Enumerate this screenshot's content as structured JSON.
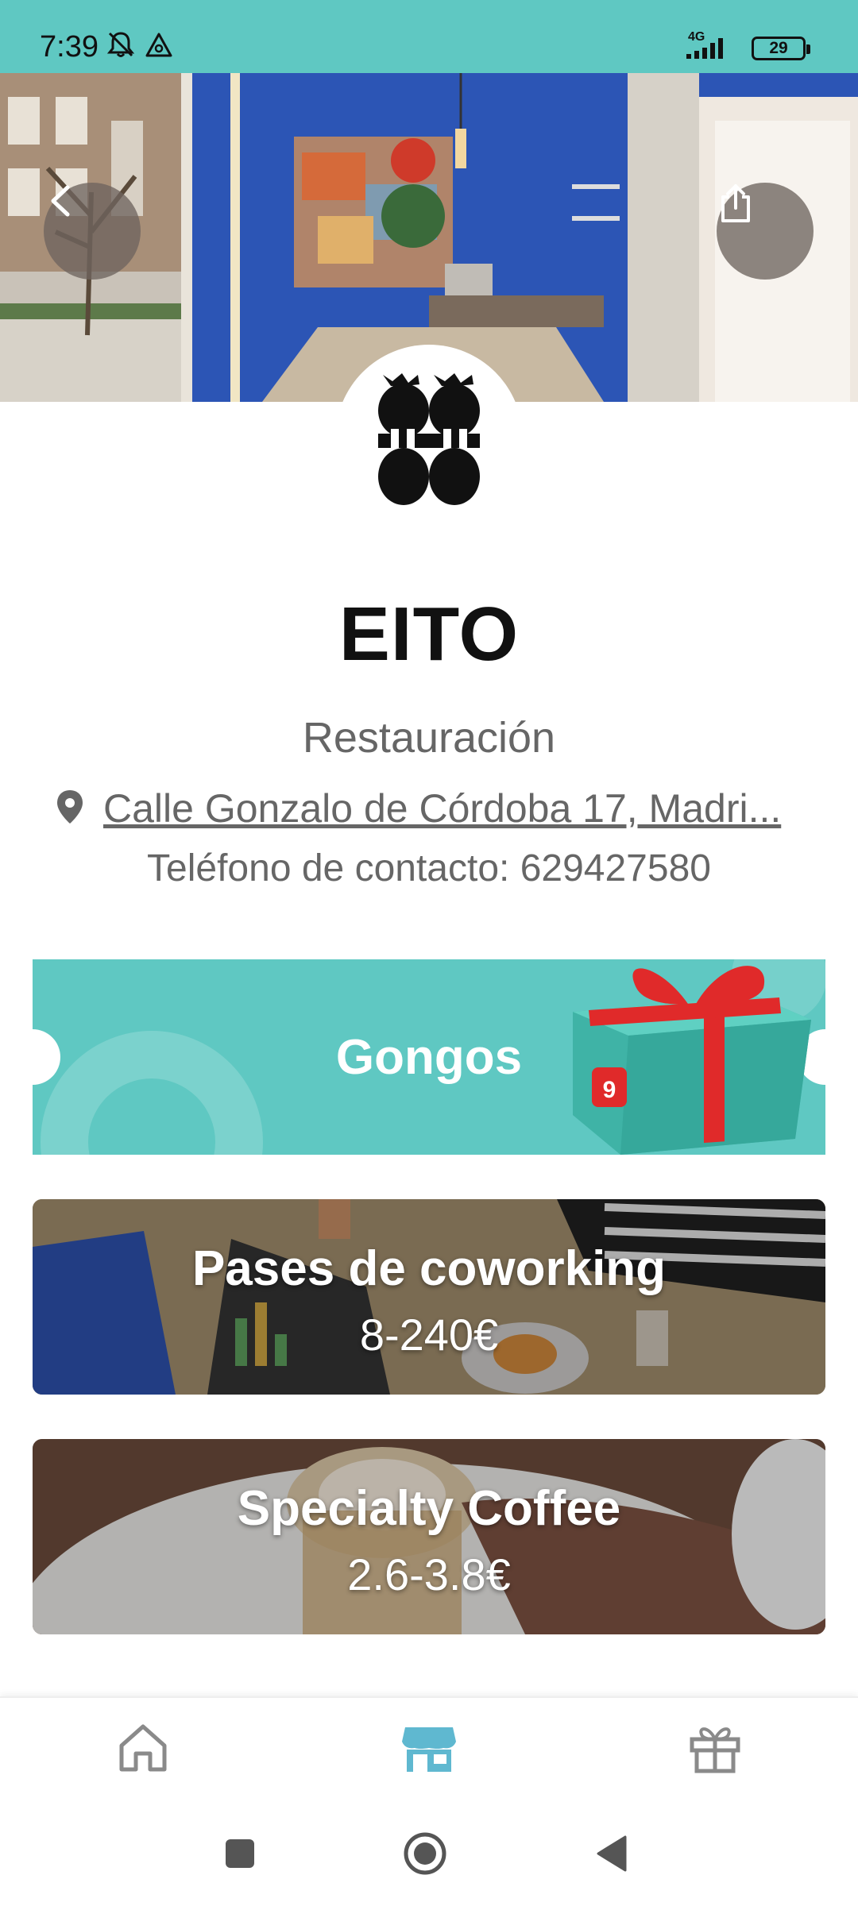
{
  "status_bar": {
    "time": "7:39",
    "network": "4G",
    "battery": "29",
    "icons": [
      "mute-bell-icon",
      "alert-triangle-icon",
      "signal-icon",
      "battery-icon"
    ]
  },
  "hero": {
    "back_icon": "chevron-left-icon",
    "share_icon": "share-icon"
  },
  "venue": {
    "name": "EITO",
    "category": "Restauración",
    "address": "Calle Gonzalo de Córdoba 17, Madri...",
    "phone": "Teléfono de contacto: 629427580"
  },
  "cards": {
    "gongos": {
      "title": "Gongos",
      "badge": "9"
    },
    "coworking": {
      "title": "Pases de coworking",
      "price": "8-240€"
    },
    "coffee": {
      "title": "Specialty Coffee",
      "price": "2.6-3.8€"
    }
  },
  "bottom_nav": {
    "items": [
      {
        "icon": "home-icon",
        "active": false
      },
      {
        "icon": "store-icon",
        "active": true
      },
      {
        "icon": "gift-icon",
        "active": false
      }
    ]
  },
  "colors": {
    "brand_teal": "#5fc8c2",
    "active_nav": "#5fb8d0",
    "inactive_nav": "#8a8a8a",
    "ribbon_red": "#e02a2a"
  }
}
